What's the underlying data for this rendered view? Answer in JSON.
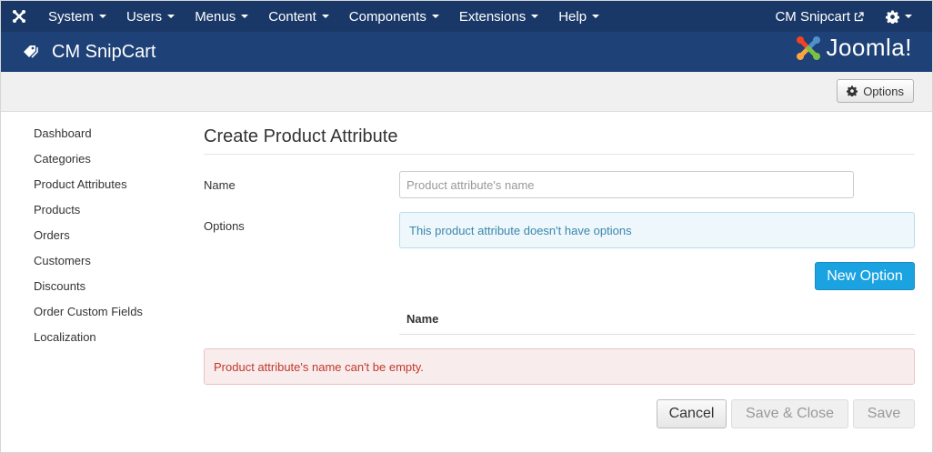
{
  "navbar": {
    "menu": [
      {
        "label": "System"
      },
      {
        "label": "Users"
      },
      {
        "label": "Menus"
      },
      {
        "label": "Content"
      },
      {
        "label": "Components"
      },
      {
        "label": "Extensions"
      },
      {
        "label": "Help"
      }
    ],
    "site_link": "CM Snipcart",
    "icons": {
      "logo": "joomla-logo-icon",
      "external": "external-link-icon",
      "settings": "gear-icon"
    }
  },
  "header": {
    "title": "CM SnipCart",
    "icon": "tag-icon",
    "brand": "Joomla!"
  },
  "toolbar": {
    "options_label": "Options"
  },
  "sidebar": {
    "items": [
      {
        "label": "Dashboard"
      },
      {
        "label": "Categories"
      },
      {
        "label": "Product Attributes"
      },
      {
        "label": "Products"
      },
      {
        "label": "Orders"
      },
      {
        "label": "Customers"
      },
      {
        "label": "Discounts"
      },
      {
        "label": "Order Custom Fields"
      },
      {
        "label": "Localization"
      }
    ]
  },
  "form": {
    "page_title": "Create Product Attribute",
    "name_label": "Name",
    "name_value": "",
    "name_placeholder": "Product attribute's name",
    "options_label": "Options",
    "options_empty_message": "This product attribute doesn't have options",
    "new_option_label": "New Option",
    "options_table_header": "Name",
    "error_message": "Product attribute's name can't be empty.",
    "cancel_label": "Cancel",
    "save_close_label": "Save & Close",
    "save_label": "Save"
  },
  "colors": {
    "navbar_bg": "#1a3867",
    "header_bg": "#1e4177",
    "primary_button": "#1aa3e0",
    "info_text": "#3a87ad",
    "error_text": "#c0392b"
  }
}
